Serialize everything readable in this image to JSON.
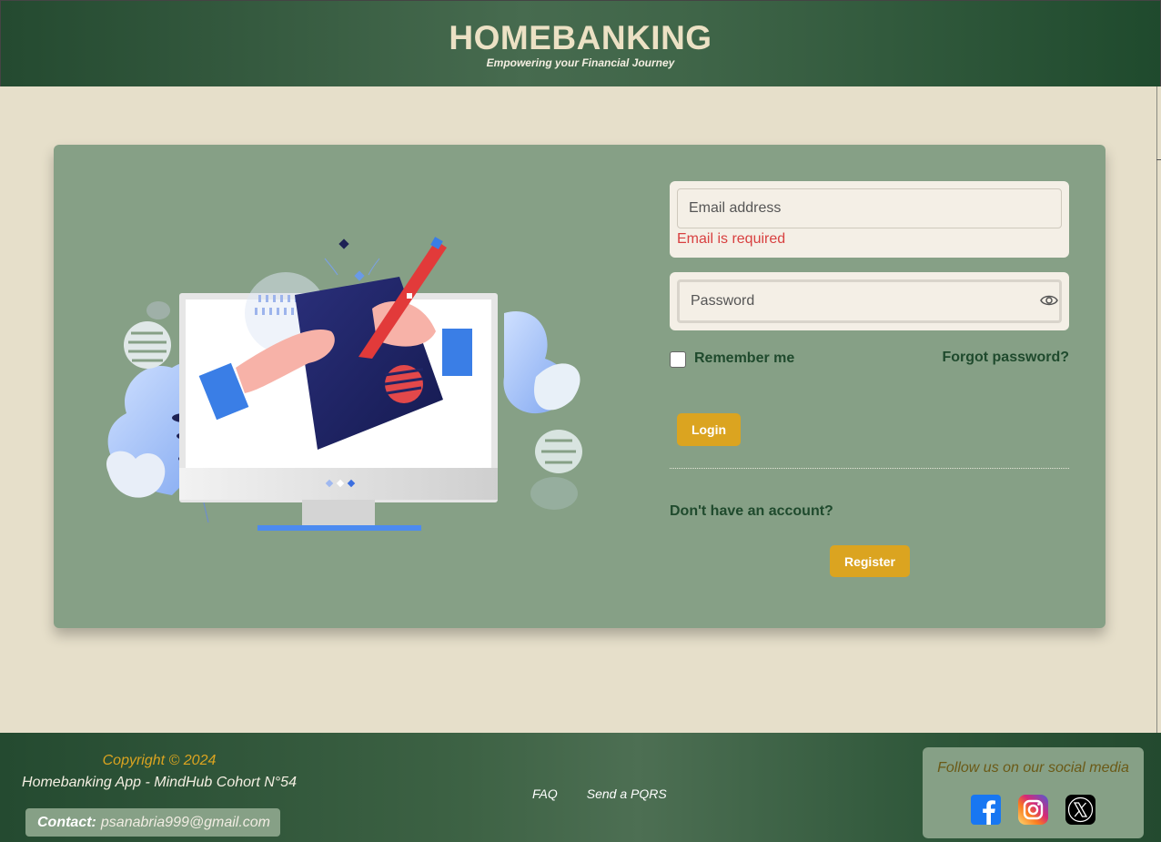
{
  "header": {
    "title": "HOMEBANKING",
    "subtitle": "Empowering your Financial Journey"
  },
  "login": {
    "email_placeholder": "Email address",
    "email_error": "Email is required",
    "password_placeholder": "Password",
    "remember_label": "Remember me",
    "forgot_label": "Forgot password?",
    "login_button": "Login",
    "no_account_text": "Don't have an account?",
    "register_button": "Register"
  },
  "footer": {
    "copyright": "Copyright © 2024",
    "app_line": "Homebanking App - MindHub Cohort N°54",
    "contact_label": "Contact:",
    "contact_email": "psanabria999@gmail.com",
    "links": [
      "FAQ",
      "Send a PQRS"
    ],
    "social_title": "Follow us on our social media",
    "social_icons": [
      "facebook-icon",
      "instagram-icon",
      "x-icon"
    ]
  },
  "colors": {
    "header_green": "#244a30",
    "card_green": "#86a086",
    "accent_gold": "#dba420",
    "error_red": "#d84040",
    "page_bg": "#e6dfca"
  }
}
